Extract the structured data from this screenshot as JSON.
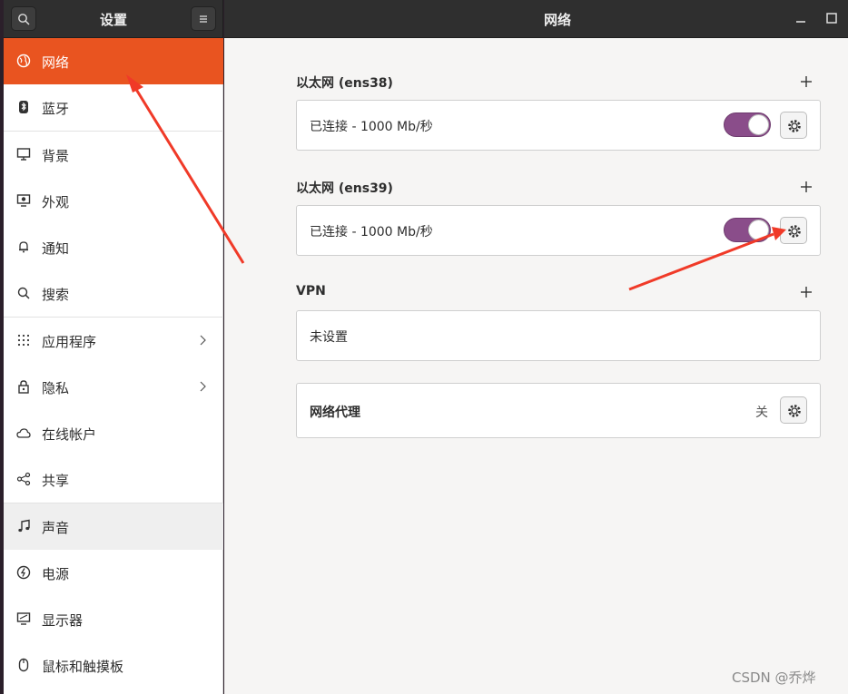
{
  "header": {
    "left_title": "设置",
    "right_title": "网络",
    "icons": [
      "search-icon",
      "hamburger-menu-icon",
      "minimize-icon",
      "maximize-icon",
      "close-icon"
    ]
  },
  "sidebar": {
    "items": [
      {
        "label": "网络",
        "icon": "globe-icon",
        "active": true
      },
      {
        "label": "蓝牙",
        "icon": "bluetooth-icon"
      },
      {
        "label": "背景",
        "icon": "monitor-icon"
      },
      {
        "label": "外观",
        "icon": "appearance-icon"
      },
      {
        "label": "通知",
        "icon": "bell-icon"
      },
      {
        "label": "搜索",
        "icon": "search-icon"
      },
      {
        "label": "应用程序",
        "icon": "apps-grid-icon",
        "chevron": true
      },
      {
        "label": "隐私",
        "icon": "lock-icon",
        "chevron": true
      },
      {
        "label": "在线帐户",
        "icon": "cloud-icon"
      },
      {
        "label": "共享",
        "icon": "share-icon"
      },
      {
        "label": "声音",
        "icon": "music-note-icon",
        "hover": true
      },
      {
        "label": "电源",
        "icon": "power-icon"
      },
      {
        "label": "显示器",
        "icon": "display-icon"
      },
      {
        "label": "鼠标和触摸板",
        "icon": "mouse-icon"
      }
    ]
  },
  "network": {
    "ethernet1": {
      "title": "以太网 (ens38)",
      "status": "已连接 - 1000 Mb/秒",
      "enabled": true
    },
    "ethernet2": {
      "title": "以太网 (ens39)",
      "status": "已连接 - 1000 Mb/秒",
      "enabled": true
    },
    "vpn": {
      "title": "VPN",
      "status": "未设置"
    },
    "proxy": {
      "label": "网络代理",
      "state": "关"
    }
  },
  "colors": {
    "accent": "#e95420",
    "toggle_on": "#8a4d8a",
    "annotation_arrow": "#f03a28"
  },
  "watermark": "CSDN @乔烨"
}
